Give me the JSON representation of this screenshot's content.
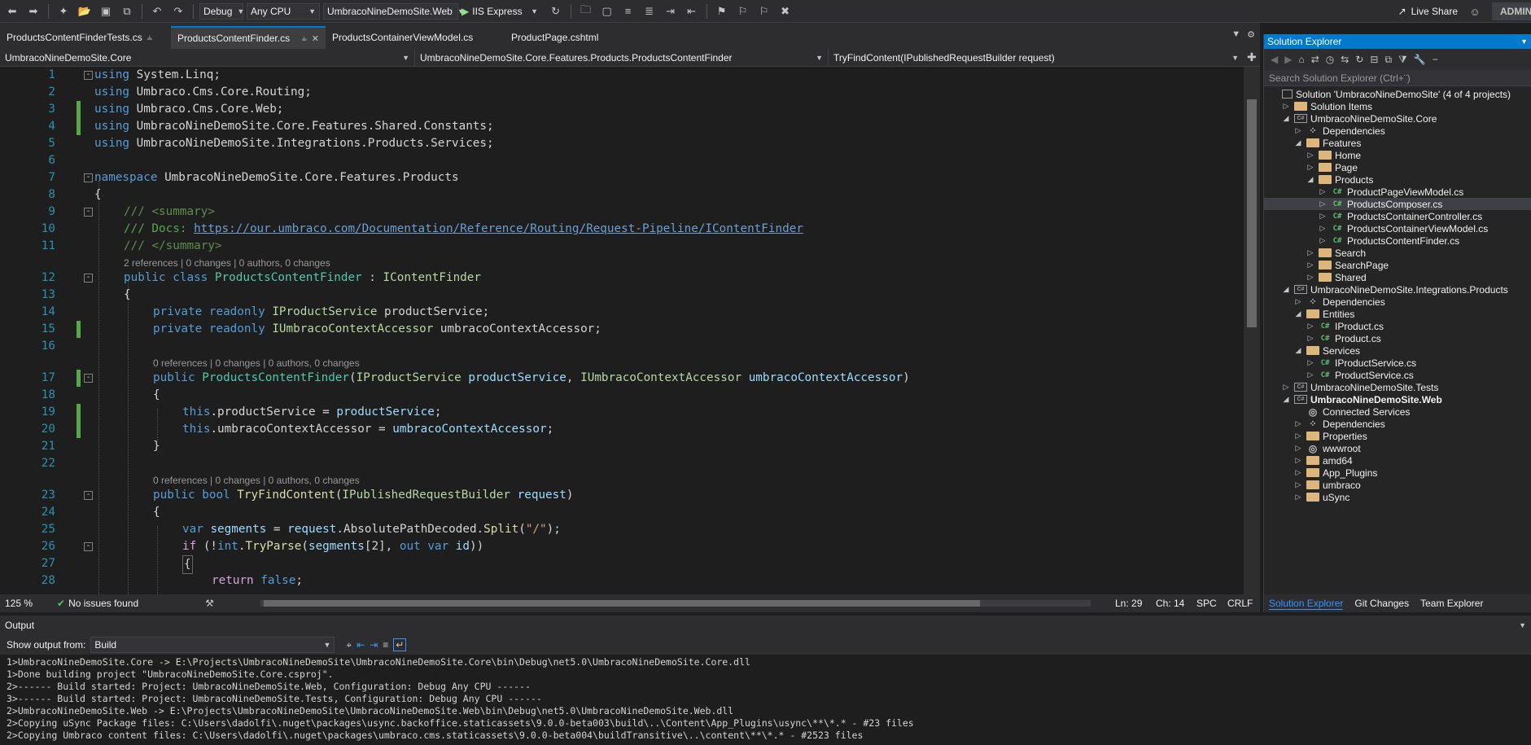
{
  "toolbar": {
    "config": "Debug",
    "platform": "Any CPU",
    "startup_project": "UmbracoNineDemoSite.Web",
    "run_target": "IIS Express",
    "live_share": "Live Share",
    "admin": "ADMIN"
  },
  "tabs": [
    {
      "label": "ProductsContentFinderTests.cs",
      "active": false
    },
    {
      "label": "ProductsContentFinder.cs",
      "active": true
    },
    {
      "label": "ProductsContainerViewModel.cs",
      "active": false
    },
    {
      "label": "ProductPage.cshtml",
      "active": false
    }
  ],
  "navbar": {
    "project": "UmbracoNineDemoSite.Core",
    "type": "UmbracoNineDemoSite.Core.Features.Products.ProductsContentFinder",
    "member": "TryFindContent(IPublishedRequestBuilder request)"
  },
  "lens": {
    "class_refs": "2 references | 0 changes | 0 authors, 0 changes",
    "ctor_refs": "0 references | 0 changes | 0 authors, 0 changes",
    "method_refs": "0 references | 0 changes | 0 authors, 0 changes"
  },
  "code": {
    "l1": [
      "using",
      " System.Linq;"
    ],
    "l2": [
      "using",
      " Umbraco.Cms.Core.Routing;"
    ],
    "l3": [
      "using",
      " Umbraco.Cms.Core.Web;"
    ],
    "l4": [
      "using",
      " UmbracoNineDemoSite.Core.Features.Shared.Constants;"
    ],
    "l5": [
      "using",
      " UmbracoNineDemoSite.Integrations.Products.Services;"
    ],
    "l7a": "namespace",
    "l7b": " UmbracoNineDemoSite.Core.Features.Products",
    "l8": "{",
    "l9a": "/// ",
    "l9b": "<summary>",
    "l10a": "/// Docs: ",
    "l10b": "https://our.umbraco.com/Documentation/Reference/Routing/Request-Pipeline/IContentFinder",
    "l11a": "/// ",
    "l11b": "</summary>",
    "l12a": "public class ",
    "l12b": "ProductsContentFinder",
    "l12c": " : ",
    "l12d": "IContentFinder",
    "l13": "{",
    "l14a": "private readonly ",
    "l14b": "IProductService",
    "l14c": " productService;",
    "l15a": "private readonly ",
    "l15b": "IUmbracoContextAccessor",
    "l15c": " umbracoContextAccessor;",
    "l17a": "public ",
    "l17b": "ProductsContentFinder",
    "l17c": "(",
    "l17d": "IProductService",
    "l17e": " productService",
    "l17f": ", ",
    "l17g": "IUmbracoContextAccessor",
    "l17h": " umbracoContextAccessor",
    "l17i": ")",
    "l18": "{",
    "l19a": "this",
    "l19b": ".productService = ",
    "l19c": "productService",
    "l19d": ";",
    "l20a": "this",
    "l20b": ".umbracoContextAccessor = ",
    "l20c": "umbracoContextAccessor",
    "l20d": ";",
    "l21": "}",
    "l23a": "public bool ",
    "l23b": "TryFindContent",
    "l23c": "(",
    "l23d": "IPublishedRequestBuilder",
    "l23e": " request",
    "l23f": ")",
    "l24": "{",
    "l25a": "var ",
    "l25b": "segments",
    "l25c": " = ",
    "l25d": "request",
    "l25e": ".AbsolutePathDecoded.",
    "l25f": "Split",
    "l25g": "(",
    "l25h": "\"/\"",
    "l25i": ");",
    "l26a": "if",
    "l26b": " (!",
    "l26c": "int",
    "l26d": ".",
    "l26e": "TryParse",
    "l26f": "(",
    "l26g": "segments",
    "l26h": "[2], ",
    "l26i": "out var ",
    "l26j": "id",
    "l26k": "))",
    "l27": "{",
    "l28a": "return ",
    "l28b": "false",
    "l28c": ";"
  },
  "status": {
    "zoom": "125 %",
    "issues": "No issues found",
    "ln": "Ln: 29",
    "ch": "Ch: 14",
    "spc": "SPC",
    "crlf": "CRLF"
  },
  "solution": {
    "title": "Solution Explorer",
    "search_placeholder": "Search Solution Explorer (Ctrl+¨)",
    "items": [
      {
        "label": "Solution 'UmbracoNineDemoSite' (4 of 4 projects)",
        "indent": 0,
        "icon": "sln",
        "tw": ""
      },
      {
        "label": "Solution Items",
        "indent": 1,
        "icon": "folder",
        "tw": "▷"
      },
      {
        "label": "UmbracoNineDemoSite.Core",
        "indent": 1,
        "icon": "proj",
        "tw": "◢"
      },
      {
        "label": "Dependencies",
        "indent": 2,
        "icon": "dep",
        "tw": "▷"
      },
      {
        "label": "Features",
        "indent": 2,
        "icon": "folder",
        "tw": "◢"
      },
      {
        "label": "Home",
        "indent": 3,
        "icon": "folder",
        "tw": "▷"
      },
      {
        "label": "Page",
        "indent": 3,
        "icon": "folder",
        "tw": "▷"
      },
      {
        "label": "Products",
        "indent": 3,
        "icon": "folder",
        "tw": "◢"
      },
      {
        "label": "ProductPageViewModel.cs",
        "indent": 4,
        "icon": "cs",
        "tw": "▷"
      },
      {
        "label": "ProductsComposer.cs",
        "indent": 4,
        "icon": "cs",
        "tw": "▷",
        "selected": true
      },
      {
        "label": "ProductsContainerController.cs",
        "indent": 4,
        "icon": "cs",
        "tw": "▷"
      },
      {
        "label": "ProductsContainerViewModel.cs",
        "indent": 4,
        "icon": "cs",
        "tw": "▷"
      },
      {
        "label": "ProductsContentFinder.cs",
        "indent": 4,
        "icon": "cs",
        "tw": "▷"
      },
      {
        "label": "Search",
        "indent": 3,
        "icon": "folder",
        "tw": "▷"
      },
      {
        "label": "SearchPage",
        "indent": 3,
        "icon": "folder",
        "tw": "▷"
      },
      {
        "label": "Shared",
        "indent": 3,
        "icon": "folder",
        "tw": "▷"
      },
      {
        "label": "UmbracoNineDemoSite.Integrations.Products",
        "indent": 1,
        "icon": "proj",
        "tw": "◢"
      },
      {
        "label": "Dependencies",
        "indent": 2,
        "icon": "dep",
        "tw": "▷"
      },
      {
        "label": "Entities",
        "indent": 2,
        "icon": "folder",
        "tw": "◢"
      },
      {
        "label": "IProduct.cs",
        "indent": 3,
        "icon": "cs",
        "tw": "▷"
      },
      {
        "label": "Product.cs",
        "indent": 3,
        "icon": "cs",
        "tw": "▷"
      },
      {
        "label": "Services",
        "indent": 2,
        "icon": "folder",
        "tw": "◢"
      },
      {
        "label": "IProductService.cs",
        "indent": 3,
        "icon": "cs",
        "tw": "▷"
      },
      {
        "label": "ProductService.cs",
        "indent": 3,
        "icon": "cs",
        "tw": "▷"
      },
      {
        "label": "UmbracoNineDemoSite.Tests",
        "indent": 1,
        "icon": "proj",
        "tw": "▷"
      },
      {
        "label": "UmbracoNineDemoSite.Web",
        "indent": 1,
        "icon": "proj",
        "tw": "◢",
        "bold": true
      },
      {
        "label": "Connected Services",
        "indent": 2,
        "icon": "globe",
        "tw": ""
      },
      {
        "label": "Dependencies",
        "indent": 2,
        "icon": "dep",
        "tw": "▷"
      },
      {
        "label": "Properties",
        "indent": 2,
        "icon": "folder",
        "tw": "▷"
      },
      {
        "label": "wwwroot",
        "indent": 2,
        "icon": "globe",
        "tw": "▷"
      },
      {
        "label": "amd64",
        "indent": 2,
        "icon": "folder",
        "tw": "▷"
      },
      {
        "label": "App_Plugins",
        "indent": 2,
        "icon": "folder",
        "tw": "▷"
      },
      {
        "label": "umbraco",
        "indent": 2,
        "icon": "folder",
        "tw": "▷"
      },
      {
        "label": "uSync",
        "indent": 2,
        "icon": "folder",
        "tw": "▷"
      }
    ],
    "bottom_tabs": [
      "Solution Explorer",
      "Git Changes",
      "Team Explorer"
    ]
  },
  "output": {
    "title": "Output",
    "show_from_label": "Show output from:",
    "show_from_value": "Build",
    "lines": [
      "1>UmbracoNineDemoSite.Core -> E:\\Projects\\UmbracoNineDemoSite\\UmbracoNineDemoSite.Core\\bin\\Debug\\net5.0\\UmbracoNineDemoSite.Core.dll",
      "1>Done building project \"UmbracoNineDemoSite.Core.csproj\".",
      "2>------ Build started: Project: UmbracoNineDemoSite.Web, Configuration: Debug Any CPU ------",
      "3>------ Build started: Project: UmbracoNineDemoSite.Tests, Configuration: Debug Any CPU ------",
      "2>UmbracoNineDemoSite.Web -> E:\\Projects\\UmbracoNineDemoSite\\UmbracoNineDemoSite.Web\\bin\\Debug\\net5.0\\UmbracoNineDemoSite.Web.dll",
      "2>Copying uSync Package files: C:\\Users\\dadolfi\\.nuget\\packages\\usync.backoffice.staticassets\\9.0.0-beta003\\build\\..\\Content\\App_Plugins\\usync\\**\\*.* - #23 files",
      "2>Copying Umbraco content files: C:\\Users\\dadolfi\\.nuget\\packages\\umbraco.cms.staticassets\\9.0.0-beta004\\buildTransitive\\..\\content\\**\\*.* - #2523 files"
    ]
  }
}
